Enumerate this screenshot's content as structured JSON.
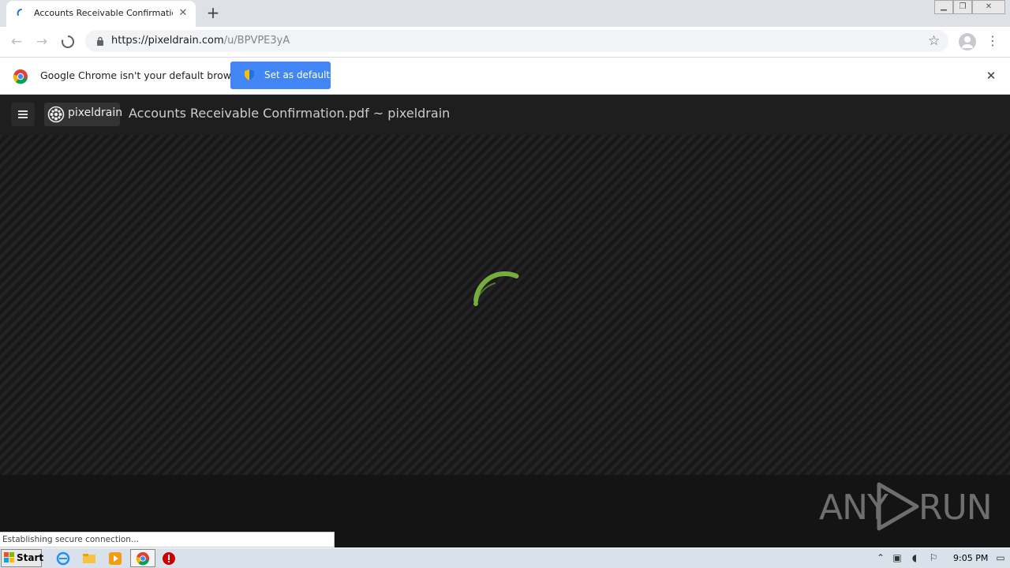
{
  "browser": {
    "tab_title": "Accounts Receivable Confirmation.p",
    "new_tab_symbol": "+",
    "url_host": "https://pixeldrain.com",
    "url_path": "/u/BPVPE3yA",
    "icons": [
      "back-arrow-icon",
      "forward-arrow-icon",
      "stop-loading-icon",
      "lock-icon",
      "bookmark-star-icon",
      "profile-icon",
      "menu-dots-icon"
    ]
  },
  "infobar": {
    "message": "Google Chrome isn't your default browser",
    "button_label": "Set as default",
    "accent_color": "#4285f4"
  },
  "page": {
    "brand_name": "pixeldrain",
    "file_title": "Accounts Receivable Confirmation.pdf ~ pixeldrain",
    "spinner_color": "#7cb342"
  },
  "watermark": {
    "left": "ANY",
    "right": "RUN"
  },
  "status_text": "Establishing secure connection...",
  "taskbar": {
    "start_label": "Start",
    "clock": "9:05 PM",
    "pinned": [
      "internet-explorer-icon",
      "file-explorer-icon",
      "media-player-icon",
      "chrome-icon",
      "stop-sign-icon"
    ]
  }
}
